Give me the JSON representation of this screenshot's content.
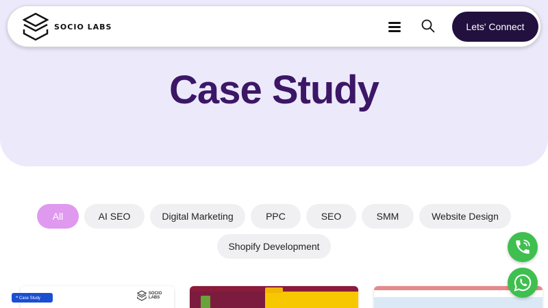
{
  "brand": {
    "name": "SOCIO LABS"
  },
  "header": {
    "connect_label": "Lets' Connect"
  },
  "hero": {
    "title": "Case Study"
  },
  "filters": [
    "All",
    "AI SEO",
    "Digital Marketing",
    "PPC",
    "SEO",
    "SMM",
    "Website Design",
    "Shopify Development"
  ],
  "active_filter": "All",
  "cards": [
    {
      "badge": "❝ Case Study",
      "logo_text": "SOCIO LABS"
    },
    {
      "brand": ""
    },
    {
      "brand": ""
    }
  ],
  "colors": {
    "hero_bg": "#ece9fb",
    "title": "#3b1766",
    "connect_bg": "#22103f",
    "active_filter": "#df9af0",
    "fab_green": "#3fbf4f"
  },
  "icons": [
    "logo-icon",
    "hamburger-menu-icon",
    "search-icon",
    "phone-icon",
    "whatsapp-icon"
  ]
}
